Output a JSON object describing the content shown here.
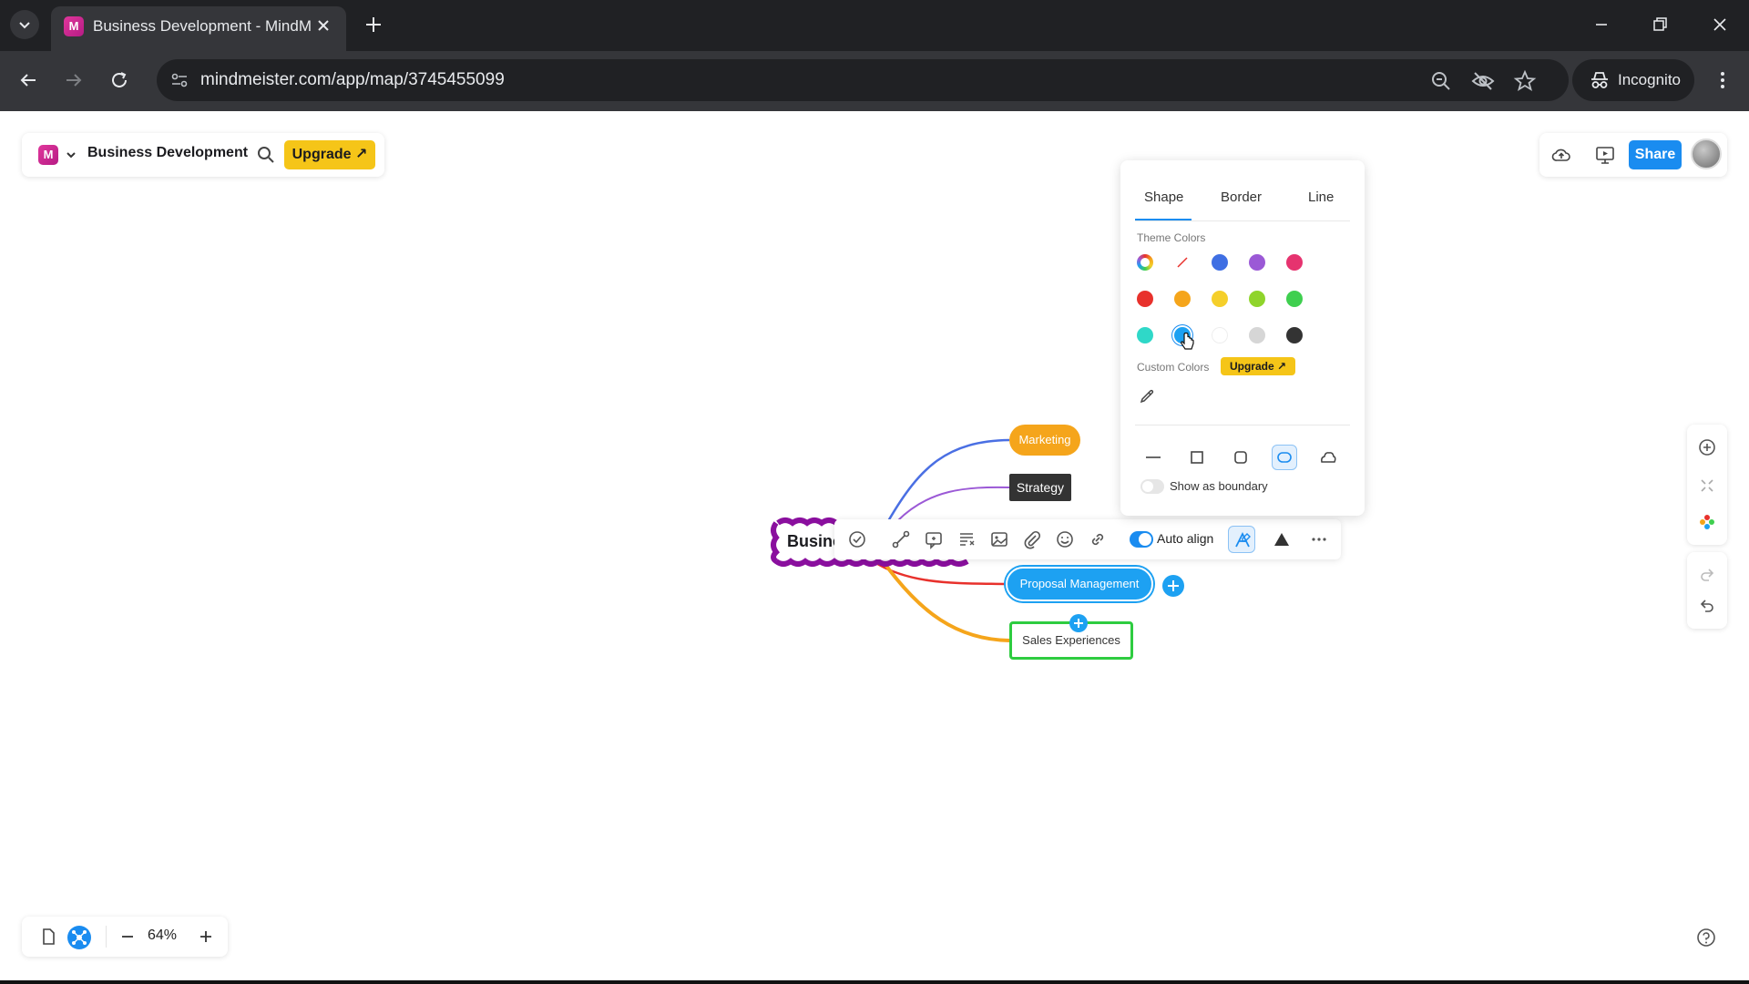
{
  "browser": {
    "tab_title": "Business Development - MindMeister",
    "tab_favicon": "M",
    "url": "mindmeister.com/app/map/3745455099",
    "incognito_label": "Incognito"
  },
  "app": {
    "logo_letter": "M",
    "map_title": "Business Development",
    "upgrade_label": "Upgrade ↗",
    "share_label": "Share"
  },
  "map": {
    "root_label": "Busine",
    "nodes": {
      "marketing": "Marketing",
      "strategy": "Strategy",
      "proposal": "Proposal Management",
      "sales": "Sales Experiences"
    },
    "branch_colors": {
      "marketing": "#4a6fe3",
      "strategy": "#9b59d6",
      "proposal": "#e8312c",
      "sales": "#f5a51b",
      "root_border": "#8a0f9e"
    }
  },
  "node_toolbar": {
    "auto_align_label": "Auto align",
    "auto_align_on": true
  },
  "style_panel": {
    "tabs": [
      "Shape",
      "Border",
      "Line"
    ],
    "active_tab": "Shape",
    "theme_colors_label": "Theme Colors",
    "theme_colors": [
      [
        "rainbow",
        "none",
        "#3f6fe3",
        "#9b59d6",
        "#e6336f"
      ],
      [
        "#e8312c",
        "#f5a51b",
        "#f5cf2a",
        "#8fd42b",
        "#3fcf4f"
      ],
      [
        "#2fd8c8",
        "#1da1f2",
        "#ffffff",
        "#d6d6d6",
        "#333333"
      ]
    ],
    "selected_color": "#1da1f2",
    "custom_colors_label": "Custom Colors",
    "upgrade_label": "Upgrade ↗",
    "shapes": [
      "line-shape",
      "rectangle-shape",
      "rounded-rectangle-shape",
      "pill-shape",
      "cloud-shape"
    ],
    "selected_shape": "pill-shape",
    "show_boundary_label": "Show as boundary",
    "show_boundary_on": false
  },
  "zoom": {
    "level": "64%"
  }
}
